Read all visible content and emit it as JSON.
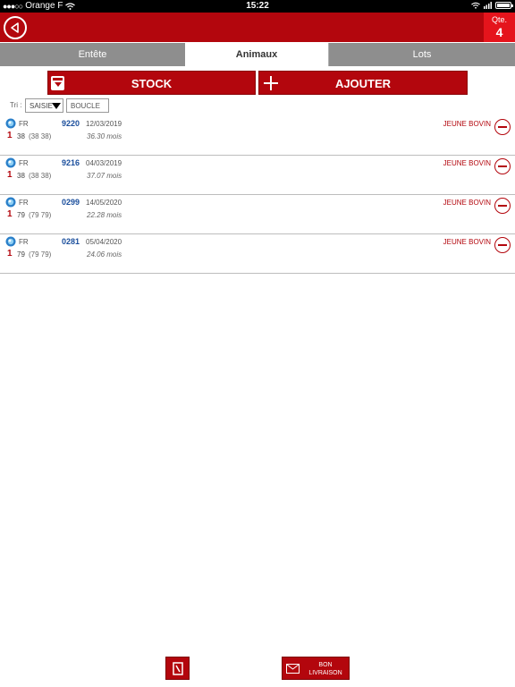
{
  "status_bar": {
    "carrier": "Orange F",
    "signal_dots": "●●●○○",
    "time": "15:22"
  },
  "header": {
    "qty_label": "Qte.",
    "qty_value": "4"
  },
  "tabs": [
    {
      "label": "Entête",
      "active": false
    },
    {
      "label": "Animaux",
      "active": true
    },
    {
      "label": "Lots",
      "active": false
    }
  ],
  "actions": {
    "stock_label": "STOCK",
    "add_label": "AJOUTER"
  },
  "sort": {
    "label": "Tri :",
    "selected": "SAISIE",
    "search_placeholder": "BOUCLE"
  },
  "animals": [
    {
      "country": "FR",
      "number": "9220",
      "date": "12/03/2019",
      "rank": "1",
      "code": "38",
      "code_paren": "(38 38)",
      "age": "36.30 mois",
      "category": "JEUNE BOVIN"
    },
    {
      "country": "FR",
      "number": "9216",
      "date": "04/03/2019",
      "rank": "1",
      "code": "38",
      "code_paren": "(38 38)",
      "age": "37.07 mois",
      "category": "JEUNE BOVIN"
    },
    {
      "country": "FR",
      "number": "0299",
      "date": "14/05/2020",
      "rank": "1",
      "code": "79",
      "code_paren": "(79 79)",
      "age": "22.28 mois",
      "category": "JEUNE BOVIN"
    },
    {
      "country": "FR",
      "number": "0281",
      "date": "05/04/2020",
      "rank": "1",
      "code": "79",
      "code_paren": "(79 79)",
      "age": "24.06 mois",
      "category": "JEUNE BOVIN"
    }
  ],
  "footer": {
    "bon_line1": "BON",
    "bon_line2": "LIVRAISON"
  },
  "colors": {
    "brand_red": "#b3060d",
    "qty_red": "#e5141c",
    "tab_gray": "#8e8e8e",
    "number_blue": "#1a4e9c"
  },
  "icons": [
    "back-arrow-icon",
    "box-icon",
    "plus-icon",
    "chevron-down-icon",
    "globe-icon",
    "minus-circle-icon",
    "document-icon",
    "mail-icon",
    "wifi-icon",
    "battery-icon"
  ]
}
